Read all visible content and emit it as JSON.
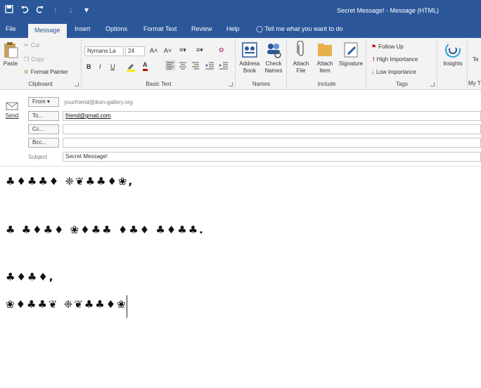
{
  "window": {
    "title": "Secret Message! - Message (HTML)"
  },
  "qat": {
    "icons": [
      "save-icon",
      "undo-icon",
      "redo-icon",
      "up-arrow-icon",
      "down-arrow-icon",
      "customize-icon"
    ]
  },
  "tabs": [
    {
      "label": "File"
    },
    {
      "label": "Message"
    },
    {
      "label": "Insert"
    },
    {
      "label": "Options"
    },
    {
      "label": "Format Text"
    },
    {
      "label": "Review"
    },
    {
      "label": "Help"
    }
  ],
  "tellme": "Tell me what you want to do",
  "ribbon": {
    "clipboard": {
      "label": "Clipboard",
      "paste": "Paste",
      "cut": "Cut",
      "copy": "Copy",
      "format_painter": "Format Painter"
    },
    "basic_text": {
      "label": "Basic Text",
      "font": "Nymans La",
      "size": "24",
      "bold": "B",
      "italic": "I",
      "underline": "U",
      "grow": "A˄",
      "shrink": "A˅",
      "font_color": "A",
      "accent_color": "#c00000"
    },
    "names": {
      "label": "Names",
      "address_book": "Address Book",
      "check_names": "Check Names"
    },
    "include": {
      "label": "Include",
      "attach_file": "Attach File",
      "attach_item": "Attach Item",
      "signature": "Signature"
    },
    "tags": {
      "label": "Tags",
      "follow_up": "Follow Up",
      "high_importance": "High Importance",
      "low_importance": "Low Importance"
    },
    "insights": {
      "label": "Insights"
    },
    "cut_off": {
      "te": "Te",
      "my": "My T"
    }
  },
  "header": {
    "from_label": "From",
    "from_value": "yourfriend@ikon-gallery.org",
    "to_label": "To...",
    "to_value": "friend@gmail.com",
    "cc_label": "Cc...",
    "bcc_label": "Bcc...",
    "subject_label": "Subject",
    "subject_value": "Secret Message!",
    "send_label": "Send"
  },
  "body": {
    "line1": "♣♦♣♣♦ ❈❦♣♣♦❀,",
    "line2": "♣ ♣♦♣♦ ❀♦♣♣ ♦♣♦ ♣♦♣♣.",
    "line3": "♣♦♣♦,",
    "line4": "❀♦♣♣❦ ❈❦♣♣♦❀"
  },
  "colors": {
    "title_bar": "#2b579a",
    "ribbon_bg": "#f3f3f3"
  }
}
